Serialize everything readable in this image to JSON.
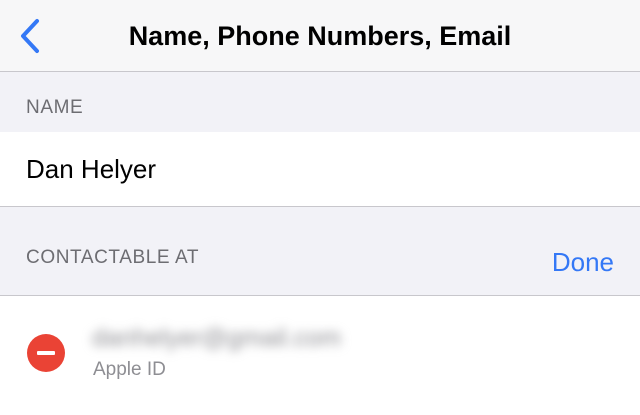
{
  "nav": {
    "title": "Name, Phone Numbers, Email",
    "back_icon": "chevron-left-icon"
  },
  "name_section": {
    "header": "NAME",
    "value": "Dan Helyer"
  },
  "contact_section": {
    "header": "CONTACTABLE AT",
    "done_label": "Done",
    "items": [
      {
        "value": "danhelyer@gmail.com",
        "subtitle": "Apple ID",
        "action_icon": "minus-circle-icon"
      }
    ]
  },
  "colors": {
    "accent": "#3478f6",
    "delete": "#ea4335",
    "background": "#f2f2f7",
    "header_text": "#6d6d72"
  }
}
